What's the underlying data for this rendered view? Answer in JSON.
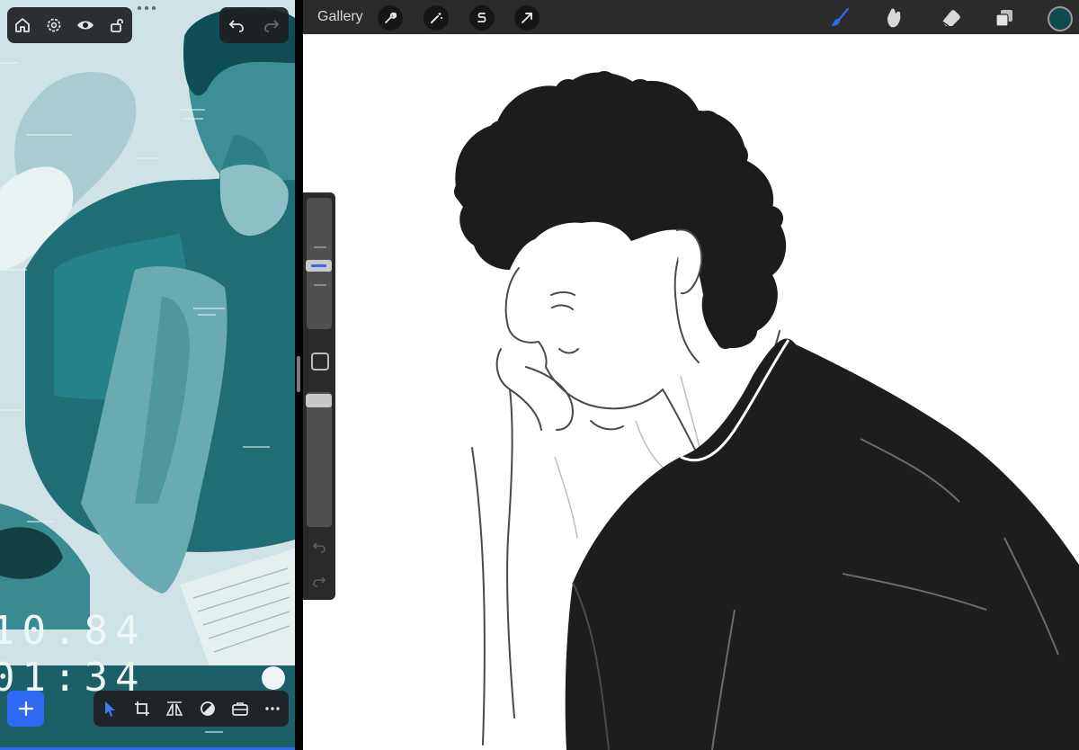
{
  "left_app": {
    "clock_lines": [
      "10.84",
      "01:34"
    ],
    "top_controls": [
      "home-icon",
      "settings-icon",
      "eye-icon",
      "unlock-icon"
    ],
    "history_controls": [
      "undo-icon",
      "redo-icon"
    ],
    "bottom_tools": [
      "select-arrow-icon",
      "crop-icon",
      "flip-icon",
      "adjust-icon",
      "toolbox-icon",
      "more-icon"
    ]
  },
  "right_app": {
    "gallery_label": "Gallery",
    "left_tools": [
      "wrench-icon",
      "magic-wand-icon",
      "selection-s-icon",
      "transform-arrow-icon"
    ],
    "right_tools": [
      "brush-icon",
      "smudge-icon",
      "eraser-icon",
      "layers-icon"
    ],
    "current_color": "#0c4b4f",
    "accent": "#2f6bf2"
  }
}
